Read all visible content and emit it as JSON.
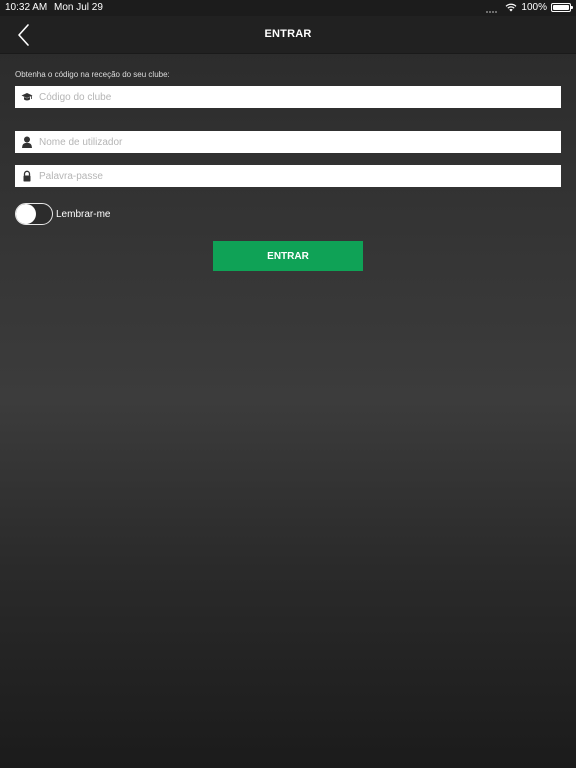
{
  "status_bar": {
    "time": "10:32 AM",
    "date": "Mon Jul 29",
    "battery": "100%",
    "battery_level": 1.0,
    "wifi_icon": "wifi-icon",
    "battery_icon": "battery-icon"
  },
  "nav": {
    "title": "ENTRAR",
    "back_icon": "chevron-left-icon"
  },
  "form": {
    "hint": "Obtenha o código na receção do seu clube:",
    "club_code": {
      "value": "",
      "placeholder": "Código do clube",
      "icon": "graduation-cap-icon"
    },
    "username": {
      "value": "",
      "placeholder": "Nome de utilizador",
      "icon": "user-icon"
    },
    "password": {
      "value": "",
      "placeholder": "Palavra-passe",
      "icon": "lock-icon"
    },
    "remember_me": {
      "label": "Lembrar-me",
      "checked": false
    },
    "submit_label": "ENTRAR"
  },
  "colors": {
    "accent": "#0fa256",
    "nav_background": "#212121",
    "status_background": "#1c1c1c"
  }
}
